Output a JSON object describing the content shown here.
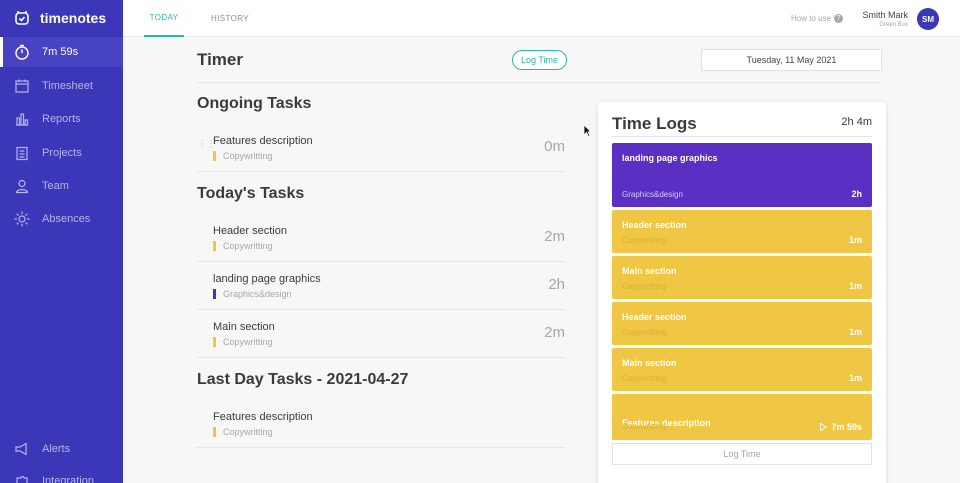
{
  "brand": {
    "name": "timenotes"
  },
  "sidebar": {
    "items": [
      {
        "label": "7m 59s",
        "icon": "stopwatch-icon"
      },
      {
        "label": "Timesheet",
        "icon": "calendar-icon"
      },
      {
        "label": "Reports",
        "icon": "bar-chart-icon"
      },
      {
        "label": "Projects",
        "icon": "clipboard-icon"
      },
      {
        "label": "Team",
        "icon": "user-icon"
      },
      {
        "label": "Absences",
        "icon": "sun-icon"
      },
      {
        "label": "Alerts",
        "icon": "megaphone-icon"
      },
      {
        "label": "Integration",
        "icon": "puzzle-icon"
      }
    ]
  },
  "tabs": [
    {
      "label": "TODAY"
    },
    {
      "label": "HISTORY"
    }
  ],
  "header": {
    "how_to_use": "How to use",
    "user_name": "Smith Mark",
    "user_company": "Green Box",
    "avatar_initials": "SM"
  },
  "timer": {
    "title": "Timer",
    "log_time_label": "Log Time",
    "date": "Tuesday, 11 May 2021"
  },
  "ongoing": {
    "title": "Ongoing Tasks",
    "tasks": [
      {
        "name": "Features description",
        "category": "Copywritting",
        "duration": "0m",
        "color": "#f0c93a"
      }
    ]
  },
  "today": {
    "title": "Today's Tasks",
    "tasks": [
      {
        "name": "Header section",
        "category": "Copywritting",
        "duration": "2m",
        "color": "#f0c93a"
      },
      {
        "name": "landing page graphics",
        "category": "Graphics&design",
        "duration": "2h",
        "color": "#4a2fc4"
      },
      {
        "name": "Main section",
        "category": "Copywritting",
        "duration": "2m",
        "color": "#f0c93a"
      }
    ]
  },
  "lastday": {
    "title": "Last Day Tasks - 2021-04-27",
    "tasks": [
      {
        "name": "Features description",
        "category": "Copywritting",
        "color": "#f0c93a"
      }
    ]
  },
  "time_logs": {
    "title": "Time Logs",
    "total": "2h 4m",
    "entries": [
      {
        "name": "landing page graphics",
        "category": "Graphics&design",
        "duration": "2h",
        "color": "#5b2fc4"
      },
      {
        "name": "Header section",
        "category": "Copywritting",
        "duration": "1m",
        "color": "#f0c744"
      },
      {
        "name": "Main section",
        "category": "Copywritting",
        "duration": "1m",
        "color": "#f0c744"
      },
      {
        "name": "Header section",
        "category": "Copywritting",
        "duration": "1m",
        "color": "#f0c744"
      },
      {
        "name": "Main section",
        "category": "Copywritting",
        "duration": "1m",
        "color": "#f0c744"
      },
      {
        "name": "Features description",
        "category": "Copywritting",
        "duration": "7m 59s",
        "color": "#f0c744"
      }
    ],
    "log_time_label": "Log Time"
  }
}
